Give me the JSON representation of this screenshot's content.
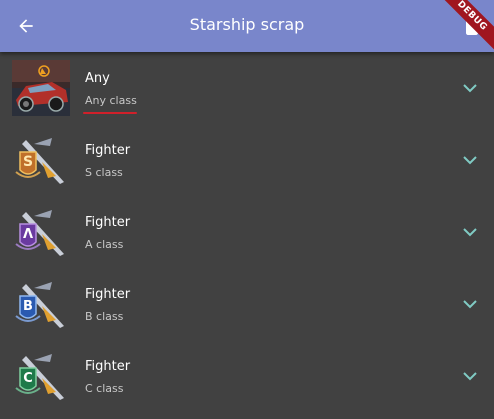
{
  "appbar": {
    "title": "Starship scrap",
    "debug_banner": "DEBUG",
    "back_icon": "arrow-back-icon",
    "action_icon": "delete-icon"
  },
  "colors": {
    "appbar": "#7986cb",
    "background": "#414141",
    "chevron": "#80cbc4",
    "underline": "#d0202a"
  },
  "items": [
    {
      "title": "Any",
      "subtitle": "Any class",
      "icon": "rocket-league-car-image"
    },
    {
      "title": "Fighter",
      "subtitle": "S class",
      "icon": "fighter-ship-s-badge-icon",
      "badge": "S"
    },
    {
      "title": "Fighter",
      "subtitle": "A class",
      "icon": "fighter-ship-a-badge-icon",
      "badge": "Λ"
    },
    {
      "title": "Fighter",
      "subtitle": "B class",
      "icon": "fighter-ship-b-badge-icon",
      "badge": "B"
    },
    {
      "title": "Fighter",
      "subtitle": "C class",
      "icon": "fighter-ship-c-badge-icon",
      "badge": "C"
    }
  ]
}
